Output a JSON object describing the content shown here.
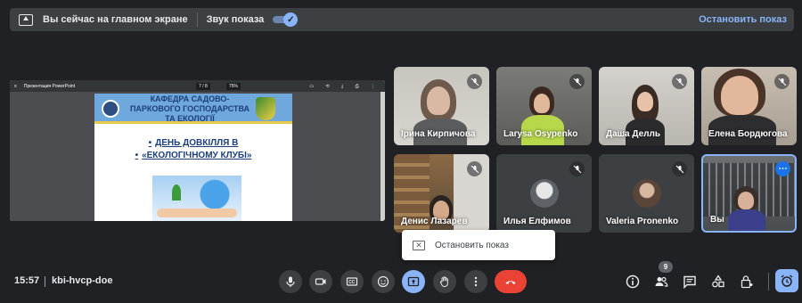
{
  "banner": {
    "title": "Вы сейчас на главном экране",
    "sound_label": "Звук показа",
    "sound_enabled": true,
    "stop_link": "Остановить показ"
  },
  "presentation": {
    "toolbar_title": "Презентация PowerPoint",
    "page": "7 / 8",
    "zoom": "75%",
    "slide": {
      "header": "КАФЕДРА САДОВО-ПАРКОВОГО ГОСПОДАРСТВА ТА ЕКОЛОГІЇ",
      "line1": "ДЕНЬ ДОВКІЛЛЯ В",
      "line2": "«ЕКОЛОГІЧНОМУ КЛУБІ»",
      "bullet": "•"
    }
  },
  "participants": [
    {
      "name": "Ірина Кирпичова",
      "muted": true
    },
    {
      "name": "Larysa Osypenko",
      "muted": true
    },
    {
      "name": "Даша Делль",
      "muted": true
    },
    {
      "name": "Елена Бордюгова",
      "muted": true
    },
    {
      "name": "Денис Лазарев",
      "muted": true
    },
    {
      "name": "Илья Елфимов",
      "muted": true
    },
    {
      "name": "Valeria Pronenko",
      "muted": true
    },
    {
      "name": "Вы",
      "muted": false
    }
  ],
  "self_tile_more": "⋯",
  "popup": {
    "label": "Остановить показ",
    "icon": "close-box-icon"
  },
  "bottom": {
    "time": "15:57",
    "meeting_code": "kbi-hvcp-doe",
    "participants_count": "9"
  },
  "colors": {
    "accent": "#8ab4f8",
    "leave": "#ea4335",
    "background": "#202124"
  }
}
